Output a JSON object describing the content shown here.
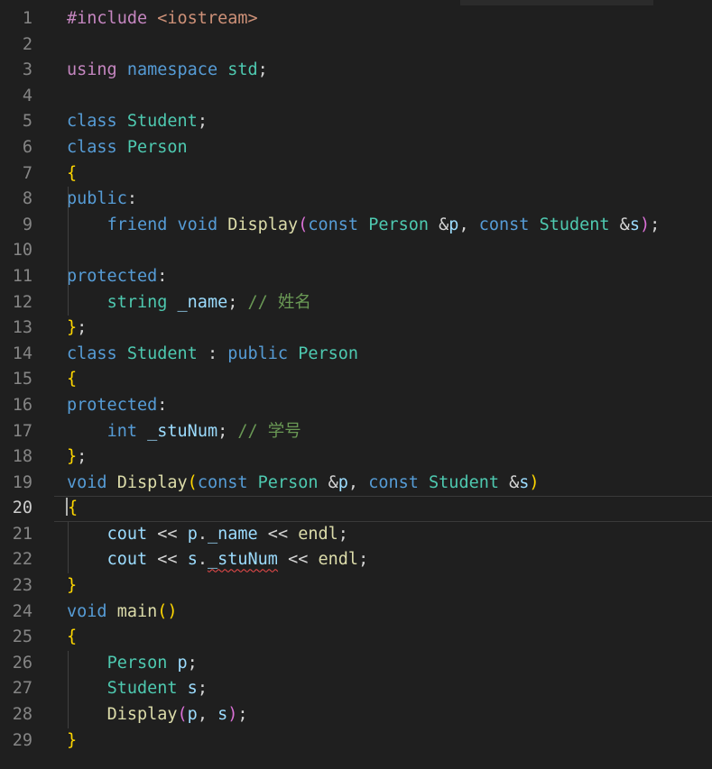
{
  "editor": {
    "active_line": 20,
    "colors": {
      "background": "#1f1f1f",
      "keyword_blue": "#569cd6",
      "control_purple": "#c586c0",
      "type_teal": "#4ec9b0",
      "function_yellow": "#dcdcaa",
      "variable_lightblue": "#9cdcfe",
      "string_orange": "#ce9178",
      "comment_green": "#6a9955",
      "bracket_gold": "#ffd700",
      "bracket_magenta": "#da70d6",
      "plain": "#d4d4d4",
      "line_number": "#858585",
      "error_squiggle": "#f14c4c"
    },
    "lines": [
      {
        "n": "1",
        "tokens": [
          {
            "t": "#include",
            "c": "#c586c0"
          },
          {
            "t": " ",
            "c": "#d4d4d4"
          },
          {
            "t": "<iostream>",
            "c": "#ce9178"
          }
        ]
      },
      {
        "n": "2",
        "tokens": []
      },
      {
        "n": "3",
        "tokens": [
          {
            "t": "using",
            "c": "#c586c0"
          },
          {
            "t": " ",
            "c": "#d4d4d4"
          },
          {
            "t": "namespace",
            "c": "#569cd6"
          },
          {
            "t": " ",
            "c": "#d4d4d4"
          },
          {
            "t": "std",
            "c": "#4ec9b0"
          },
          {
            "t": ";",
            "c": "#d4d4d4"
          }
        ]
      },
      {
        "n": "4",
        "tokens": []
      },
      {
        "n": "5",
        "tokens": [
          {
            "t": "class",
            "c": "#569cd6"
          },
          {
            "t": " ",
            "c": "#d4d4d4"
          },
          {
            "t": "Student",
            "c": "#4ec9b0"
          },
          {
            "t": ";",
            "c": "#d4d4d4"
          }
        ]
      },
      {
        "n": "6",
        "tokens": [
          {
            "t": "class",
            "c": "#569cd6"
          },
          {
            "t": " ",
            "c": "#d4d4d4"
          },
          {
            "t": "Person",
            "c": "#4ec9b0"
          }
        ]
      },
      {
        "n": "7",
        "tokens": [
          {
            "t": "{",
            "c": "#ffd700"
          }
        ]
      },
      {
        "n": "8",
        "tokens": [
          {
            "t": "public",
            "c": "#569cd6"
          },
          {
            "t": ":",
            "c": "#d4d4d4"
          }
        ]
      },
      {
        "n": "9",
        "tokens": [
          {
            "t": "    ",
            "c": "#d4d4d4"
          },
          {
            "t": "friend",
            "c": "#569cd6"
          },
          {
            "t": " ",
            "c": "#d4d4d4"
          },
          {
            "t": "void",
            "c": "#569cd6"
          },
          {
            "t": " ",
            "c": "#d4d4d4"
          },
          {
            "t": "Display",
            "c": "#dcdcaa"
          },
          {
            "t": "(",
            "c": "#da70d6"
          },
          {
            "t": "const",
            "c": "#569cd6"
          },
          {
            "t": " ",
            "c": "#d4d4d4"
          },
          {
            "t": "Person",
            "c": "#4ec9b0"
          },
          {
            "t": " ",
            "c": "#d4d4d4"
          },
          {
            "t": "&",
            "c": "#d4d4d4"
          },
          {
            "t": "p",
            "c": "#9cdcfe"
          },
          {
            "t": ", ",
            "c": "#d4d4d4"
          },
          {
            "t": "const",
            "c": "#569cd6"
          },
          {
            "t": " ",
            "c": "#d4d4d4"
          },
          {
            "t": "Student",
            "c": "#4ec9b0"
          },
          {
            "t": " ",
            "c": "#d4d4d4"
          },
          {
            "t": "&",
            "c": "#d4d4d4"
          },
          {
            "t": "s",
            "c": "#9cdcfe"
          },
          {
            "t": ")",
            "c": "#da70d6"
          },
          {
            "t": ";",
            "c": "#d4d4d4"
          }
        ]
      },
      {
        "n": "10",
        "tokens": []
      },
      {
        "n": "11",
        "tokens": [
          {
            "t": "protected",
            "c": "#569cd6"
          },
          {
            "t": ":",
            "c": "#d4d4d4"
          }
        ]
      },
      {
        "n": "12",
        "tokens": [
          {
            "t": "    ",
            "c": "#d4d4d4"
          },
          {
            "t": "string",
            "c": "#4ec9b0"
          },
          {
            "t": " ",
            "c": "#d4d4d4"
          },
          {
            "t": "_name",
            "c": "#9cdcfe"
          },
          {
            "t": "; ",
            "c": "#d4d4d4"
          },
          {
            "t": "// 姓名",
            "c": "#6a9955"
          }
        ]
      },
      {
        "n": "13",
        "tokens": [
          {
            "t": "}",
            "c": "#ffd700"
          },
          {
            "t": ";",
            "c": "#d4d4d4"
          }
        ]
      },
      {
        "n": "14",
        "tokens": [
          {
            "t": "class",
            "c": "#569cd6"
          },
          {
            "t": " ",
            "c": "#d4d4d4"
          },
          {
            "t": "Student",
            "c": "#4ec9b0"
          },
          {
            "t": " : ",
            "c": "#d4d4d4"
          },
          {
            "t": "public",
            "c": "#569cd6"
          },
          {
            "t": " ",
            "c": "#d4d4d4"
          },
          {
            "t": "Person",
            "c": "#4ec9b0"
          }
        ]
      },
      {
        "n": "15",
        "tokens": [
          {
            "t": "{",
            "c": "#ffd700"
          }
        ]
      },
      {
        "n": "16",
        "tokens": [
          {
            "t": "protected",
            "c": "#569cd6"
          },
          {
            "t": ":",
            "c": "#d4d4d4"
          }
        ]
      },
      {
        "n": "17",
        "tokens": [
          {
            "t": "    ",
            "c": "#d4d4d4"
          },
          {
            "t": "int",
            "c": "#569cd6"
          },
          {
            "t": " ",
            "c": "#d4d4d4"
          },
          {
            "t": "_stuNum",
            "c": "#9cdcfe"
          },
          {
            "t": "; ",
            "c": "#d4d4d4"
          },
          {
            "t": "// 学号",
            "c": "#6a9955"
          }
        ]
      },
      {
        "n": "18",
        "tokens": [
          {
            "t": "}",
            "c": "#ffd700"
          },
          {
            "t": ";",
            "c": "#d4d4d4"
          }
        ]
      },
      {
        "n": "19",
        "tokens": [
          {
            "t": "void",
            "c": "#569cd6"
          },
          {
            "t": " ",
            "c": "#d4d4d4"
          },
          {
            "t": "Display",
            "c": "#dcdcaa"
          },
          {
            "t": "(",
            "c": "#ffd700"
          },
          {
            "t": "const",
            "c": "#569cd6"
          },
          {
            "t": " ",
            "c": "#d4d4d4"
          },
          {
            "t": "Person",
            "c": "#4ec9b0"
          },
          {
            "t": " ",
            "c": "#d4d4d4"
          },
          {
            "t": "&",
            "c": "#d4d4d4"
          },
          {
            "t": "p",
            "c": "#9cdcfe"
          },
          {
            "t": ", ",
            "c": "#d4d4d4"
          },
          {
            "t": "const",
            "c": "#569cd6"
          },
          {
            "t": " ",
            "c": "#d4d4d4"
          },
          {
            "t": "Student",
            "c": "#4ec9b0"
          },
          {
            "t": " ",
            "c": "#d4d4d4"
          },
          {
            "t": "&",
            "c": "#d4d4d4"
          },
          {
            "t": "s",
            "c": "#9cdcfe"
          },
          {
            "t": ")",
            "c": "#ffd700"
          }
        ]
      },
      {
        "n": "20",
        "tokens": [
          {
            "t": "{",
            "c": "#ffd700",
            "cursor": true
          }
        ]
      },
      {
        "n": "21",
        "tokens": [
          {
            "t": "    ",
            "c": "#d4d4d4"
          },
          {
            "t": "cout",
            "c": "#9cdcfe"
          },
          {
            "t": " << ",
            "c": "#d4d4d4"
          },
          {
            "t": "p",
            "c": "#9cdcfe"
          },
          {
            "t": ".",
            "c": "#d4d4d4"
          },
          {
            "t": "_name",
            "c": "#9cdcfe"
          },
          {
            "t": " << ",
            "c": "#d4d4d4"
          },
          {
            "t": "endl",
            "c": "#dcdcaa"
          },
          {
            "t": ";",
            "c": "#d4d4d4"
          }
        ]
      },
      {
        "n": "22",
        "tokens": [
          {
            "t": "    ",
            "c": "#d4d4d4"
          },
          {
            "t": "cout",
            "c": "#9cdcfe"
          },
          {
            "t": " << ",
            "c": "#d4d4d4"
          },
          {
            "t": "s",
            "c": "#9cdcfe"
          },
          {
            "t": ".",
            "c": "#d4d4d4"
          },
          {
            "t": "_stuNum",
            "c": "#9cdcfe",
            "error": true
          },
          {
            "t": " << ",
            "c": "#d4d4d4"
          },
          {
            "t": "endl",
            "c": "#dcdcaa"
          },
          {
            "t": ";",
            "c": "#d4d4d4"
          }
        ]
      },
      {
        "n": "23",
        "tokens": [
          {
            "t": "}",
            "c": "#ffd700"
          }
        ]
      },
      {
        "n": "24",
        "tokens": [
          {
            "t": "void",
            "c": "#569cd6"
          },
          {
            "t": " ",
            "c": "#d4d4d4"
          },
          {
            "t": "main",
            "c": "#dcdcaa"
          },
          {
            "t": "()",
            "c": "#ffd700"
          }
        ]
      },
      {
        "n": "25",
        "tokens": [
          {
            "t": "{",
            "c": "#ffd700"
          }
        ]
      },
      {
        "n": "26",
        "tokens": [
          {
            "t": "    ",
            "c": "#d4d4d4"
          },
          {
            "t": "Person",
            "c": "#4ec9b0"
          },
          {
            "t": " ",
            "c": "#d4d4d4"
          },
          {
            "t": "p",
            "c": "#9cdcfe"
          },
          {
            "t": ";",
            "c": "#d4d4d4"
          }
        ]
      },
      {
        "n": "27",
        "tokens": [
          {
            "t": "    ",
            "c": "#d4d4d4"
          },
          {
            "t": "Student",
            "c": "#4ec9b0"
          },
          {
            "t": " ",
            "c": "#d4d4d4"
          },
          {
            "t": "s",
            "c": "#9cdcfe"
          },
          {
            "t": ";",
            "c": "#d4d4d4"
          }
        ]
      },
      {
        "n": "28",
        "tokens": [
          {
            "t": "    ",
            "c": "#d4d4d4"
          },
          {
            "t": "Display",
            "c": "#dcdcaa"
          },
          {
            "t": "(",
            "c": "#da70d6"
          },
          {
            "t": "p",
            "c": "#9cdcfe"
          },
          {
            "t": ", ",
            "c": "#d4d4d4"
          },
          {
            "t": "s",
            "c": "#9cdcfe"
          },
          {
            "t": ")",
            "c": "#da70d6"
          },
          {
            "t": ";",
            "c": "#d4d4d4"
          }
        ]
      },
      {
        "n": "29",
        "tokens": [
          {
            "t": "}",
            "c": "#ffd700"
          }
        ]
      }
    ]
  }
}
